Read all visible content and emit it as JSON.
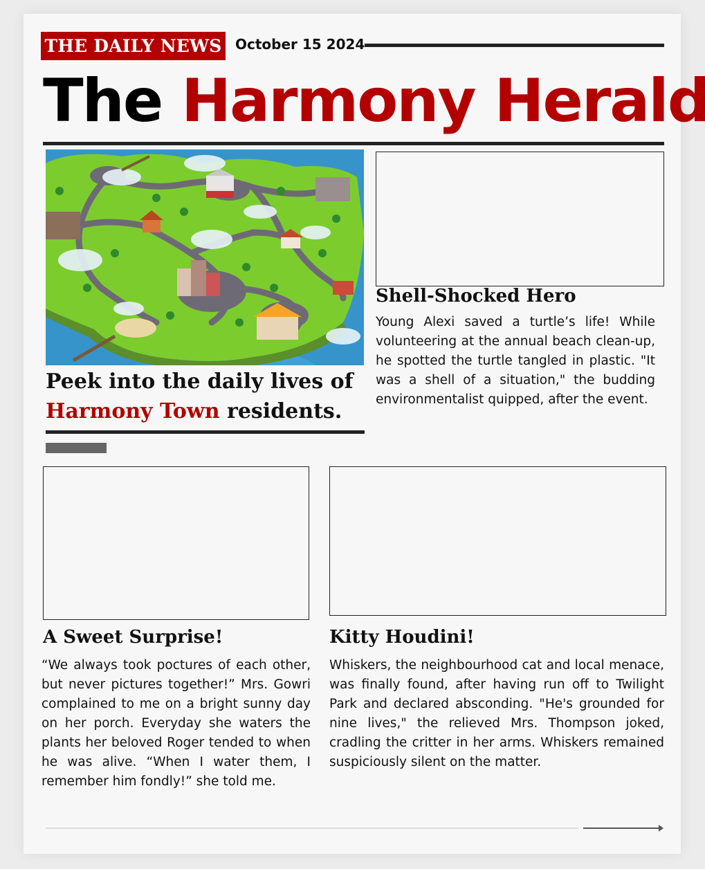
{
  "header": {
    "badge": "THE DAILY NEWS",
    "date": "October 15 2024",
    "title_part1": "The",
    "title_part2": "Harmony Herald"
  },
  "lead_story": {
    "headline_before": "Peek into the daily lives of",
    "headline_highlight": "Harmony Town",
    "headline_after": "residents."
  },
  "stories": [
    {
      "headline": "Shell-Shocked Hero",
      "body": "Young Alexi saved a turtle’s life! While volunteering at the annual beach clean-up, he spotted the turtle tangled in plastic. \"It was a shell of a situation,\" the budding environmentalist quipped, after the event."
    },
    {
      "headline": "A Sweet Surprise!",
      "body": "“We always took poctures of each other, but never pictures together!” Mrs. Gowri complained to me on a bright sunny day on her porch. Everyday she waters the plants her beloved Roger tended to when he was alive. “When I water them, I remember him fondly!” she told me."
    },
    {
      "headline": "Kitty Houdini!",
      "body": "Whiskers, the neighbourhood cat and local menace, was finally found, after having run off to Twilight Park and declared absconding. \"He's grounded for nine lives,\" the relieved Mrs. Thompson joked, cradling the critter in her arms. Whiskers remained suspiciously silent on the matter."
    }
  ],
  "colors": {
    "accent": "#b30000",
    "rule": "#222222"
  }
}
